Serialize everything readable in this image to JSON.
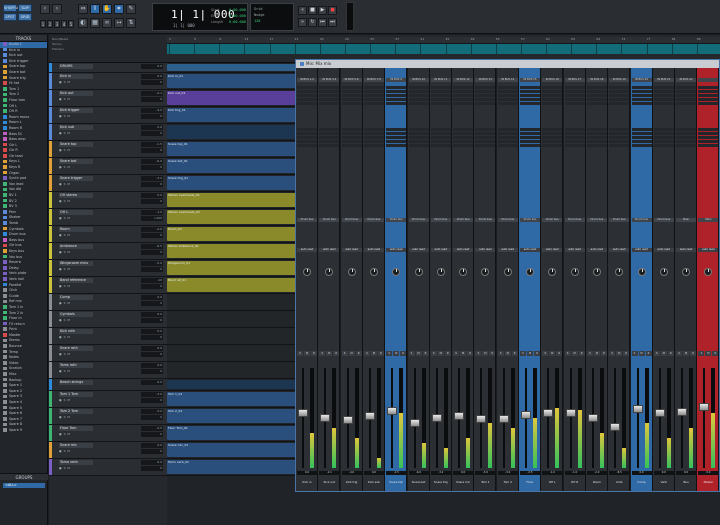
{
  "transport": {
    "mode_buttons": [
      "SHUFFLE",
      "SLIP",
      "SPOT",
      "GRID"
    ],
    "counter_main": "1| 1| 000",
    "counter_sub": "1| 1| 000",
    "counter_side_labels": [
      "Start",
      "End",
      "Length"
    ],
    "counter_side_values": [
      "0:00.000",
      "0:00.000",
      "0:00.000"
    ],
    "nudge_label": "Nudge",
    "grid_label": "Grid",
    "tempo_label": "120"
  },
  "sidebar": {
    "tracks_header": "TRACKS",
    "groups_header": "GROUPS",
    "group_all": "<ALL>",
    "items": [
      {
        "name": "Audio 1",
        "color": "#7b5fc2"
      },
      {
        "name": "Kick in",
        "color": "#5b8ad9"
      },
      {
        "name": "Kick out",
        "color": "#5b8ad9"
      },
      {
        "name": "Kick trigger",
        "color": "#5b8ad9"
      },
      {
        "name": "Snare top",
        "color": "#e0a038"
      },
      {
        "name": "Snare bot",
        "color": "#e0a038"
      },
      {
        "name": "Snare trig",
        "color": "#e0a038"
      },
      {
        "name": "Hi hat",
        "color": "#d94a4a"
      },
      {
        "name": "Tom 1",
        "color": "#3fb573"
      },
      {
        "name": "Tom 2",
        "color": "#3fb573"
      },
      {
        "name": "Floor tom",
        "color": "#3fb573"
      },
      {
        "name": "OH L",
        "color": "#3fb573"
      },
      {
        "name": "OH R",
        "color": "#3fb573"
      },
      {
        "name": "Room mono",
        "color": "#2f8ad9"
      },
      {
        "name": "Room L",
        "color": "#2f8ad9"
      },
      {
        "name": "Room R",
        "color": "#2f8ad9"
      },
      {
        "name": "Bass DI",
        "color": "#c35fc2"
      },
      {
        "name": "Bass amp",
        "color": "#c35fc2"
      },
      {
        "name": "Gtr L",
        "color": "#d94a4a"
      },
      {
        "name": "Gtr R",
        "color": "#d94a4a"
      },
      {
        "name": "Gtr lead",
        "color": "#d94a4a"
      },
      {
        "name": "Keys L",
        "color": "#e0a038"
      },
      {
        "name": "Keys R",
        "color": "#e0a038"
      },
      {
        "name": "Organ",
        "color": "#e0a038"
      },
      {
        "name": "Synth pad",
        "color": "#7b5fc2"
      },
      {
        "name": "Vox lead",
        "color": "#3fb573"
      },
      {
        "name": "Vox dbl",
        "color": "#3fb573"
      },
      {
        "name": "BV 1",
        "color": "#3fb573"
      },
      {
        "name": "BV 2",
        "color": "#3fb573"
      },
      {
        "name": "BV 3",
        "color": "#3fb573"
      },
      {
        "name": "Perc",
        "color": "#5b8ad9"
      },
      {
        "name": "Shaker",
        "color": "#5b8ad9"
      },
      {
        "name": "Tamb",
        "color": "#5b8ad9"
      },
      {
        "name": "Cymbals",
        "color": "#e0a038"
      },
      {
        "name": "Drum bus",
        "color": "#2f8ad9"
      },
      {
        "name": "Bass bus",
        "color": "#c35fc2"
      },
      {
        "name": "Gtr bus",
        "color": "#d94a4a"
      },
      {
        "name": "Keys bus",
        "color": "#e0a038"
      },
      {
        "name": "Vox bus",
        "color": "#3fb573"
      },
      {
        "name": "Reverb",
        "color": "#7b5fc2"
      },
      {
        "name": "Delay",
        "color": "#7b5fc2"
      },
      {
        "name": "Verb plate",
        "color": "#7b5fc2"
      },
      {
        "name": "Verb hall",
        "color": "#7b5fc2"
      },
      {
        "name": "Parallel",
        "color": "#2f8ad9"
      },
      {
        "name": "Click",
        "color": "#8a8f96"
      },
      {
        "name": "Guide",
        "color": "#8a8f96"
      },
      {
        "name": "Ref mix",
        "color": "#8a8f96"
      },
      {
        "name": "Tom 1 in",
        "color": "#3fb573"
      },
      {
        "name": "Tom 2 in",
        "color": "#3fb573"
      },
      {
        "name": "Floor in",
        "color": "#3fb573"
      },
      {
        "name": "FX return",
        "color": "#7b5fc2"
      },
      {
        "name": "Print",
        "color": "#8a8f96"
      },
      {
        "name": "Master",
        "color": "#d94a4a"
      },
      {
        "name": "Stems",
        "color": "#8a8f96"
      },
      {
        "name": "Bounce",
        "color": "#8a8f96"
      },
      {
        "name": "Temp",
        "color": "#8a8f96"
      },
      {
        "name": "Notes",
        "color": "#8a8f96"
      },
      {
        "name": "Video",
        "color": "#8a8f96"
      },
      {
        "name": "Scratch",
        "color": "#8a8f96"
      },
      {
        "name": "Misc",
        "color": "#8a8f96"
      },
      {
        "name": "Backup",
        "color": "#8a8f96"
      },
      {
        "name": "Spare 1",
        "color": "#8a8f96"
      },
      {
        "name": "Spare 2",
        "color": "#8a8f96"
      },
      {
        "name": "Spare 3",
        "color": "#8a8f96"
      },
      {
        "name": "Spare 4",
        "color": "#8a8f96"
      },
      {
        "name": "Spare 5",
        "color": "#8a8f96"
      },
      {
        "name": "Spare 6",
        "color": "#8a8f96"
      },
      {
        "name": "Spare 7",
        "color": "#8a8f96"
      },
      {
        "name": "Spare 8",
        "color": "#8a8f96"
      },
      {
        "name": "Spare 9",
        "color": "#8a8f96"
      }
    ]
  },
  "edit": {
    "ruler_names": [
      "Bars|Beats",
      "Tempo",
      "Markers"
    ],
    "ruler_ticks": [
      "1",
      "5",
      "9",
      "13",
      "17",
      "21",
      "25",
      "29",
      "33",
      "37",
      "41",
      "45",
      "49",
      "53",
      "57",
      "61",
      "65",
      "69",
      "73",
      "77",
      "81",
      "85"
    ],
    "tracks": [
      {
        "name": "DRUMS",
        "color": "#2f8ad9",
        "vol": "0.0",
        "vol2": "0",
        "clip_color": "#2d5f8a",
        "clip_label": "",
        "h": 10
      },
      {
        "name": "Kick in",
        "color": "#5b8ad9",
        "vol": "0.0",
        "vol2": "0",
        "clip_color": "#2a4f7d",
        "clip_label": "Kick in_01",
        "h": 17
      },
      {
        "name": "Kick out",
        "color": "#5b8ad9",
        "vol": "-2.1",
        "vol2": "0",
        "clip_color": "#5a3f9a",
        "clip_label": "Kick out_01",
        "h": 17
      },
      {
        "name": "Kick trigger",
        "color": "#5b8ad9",
        "vol": "-4.0",
        "vol2": "0",
        "clip_color": "#2a4f7d",
        "clip_label": "Kick trig_01",
        "h": 17
      },
      {
        "name": "Kick sub",
        "color": "#5b8ad9",
        "vol": "0.0",
        "vol2": "0",
        "clip_color": "#1c3550",
        "clip_label": "",
        "h": 17
      },
      {
        "name": "Snare top",
        "color": "#e0a038",
        "vol": "-1.5",
        "vol2": "0",
        "clip_color": "#2a4f7d",
        "clip_label": "Snare top_01",
        "h": 17
      },
      {
        "name": "Snare bot",
        "color": "#e0a038",
        "vol": "-6.0",
        "vol2": "0",
        "clip_color": "#2a4f7d",
        "clip_label": "Snare bot_01",
        "h": 17
      },
      {
        "name": "Snare trigger",
        "color": "#e0a038",
        "vol": "-3.2",
        "vol2": "0",
        "clip_color": "#2a4f7d",
        "clip_label": "Snare trig_01",
        "h": 17
      },
      {
        "name": "OH stereo",
        "color": "#c9c43b",
        "vol": "0.0",
        "vol2": "0",
        "clip_color": "#8a8a2a",
        "clip_label": "Stereo overheads_01",
        "h": 17
      },
      {
        "name": "OH L",
        "color": "#c9c43b",
        "vol": "-1.0",
        "vol2": "<100",
        "clip_color": "#8a8a2a",
        "clip_label": "Stereo overheads_02",
        "h": 17
      },
      {
        "name": "Room",
        "color": "#c9c43b",
        "vol": "-2.0",
        "vol2": "0",
        "clip_color": "#8a8a2a",
        "clip_label": "Room_01",
        "h": 17
      },
      {
        "name": "Ambiance",
        "color": "#c9c43b",
        "vol": "-8.5",
        "vol2": "0",
        "clip_color": "#8a8a2a",
        "clip_label": "Stereo ambiance_01",
        "h": 17
      },
      {
        "name": "Wingsroom mics",
        "color": "#c9c43b",
        "vol": "-5.0",
        "vol2": "0",
        "clip_color": "#8a8a2a",
        "clip_label": "Wingsroom_01",
        "h": 17
      },
      {
        "name": "Band reference",
        "color": "#c9c43b",
        "vol": "-10",
        "vol2": "0",
        "clip_color": "#8a8a2a",
        "clip_label": "Band ref_01",
        "h": 17
      },
      {
        "name": "Comp",
        "color": "#8a8f96",
        "vol": "0.0",
        "vol2": "0",
        "clip_color": "#232629",
        "clip_label": "",
        "h": 17
      },
      {
        "name": "Cymbals",
        "color": "#8a8f96",
        "vol": "0.0",
        "vol2": "0",
        "clip_color": "#232629",
        "clip_label": "",
        "h": 17
      },
      {
        "name": "Kick roth",
        "color": "#8a8f96",
        "vol": "0.0",
        "vol2": "0",
        "clip_color": "#232629",
        "clip_label": "",
        "h": 17
      },
      {
        "name": "Snare roth",
        "color": "#8a8f96",
        "vol": "0.0",
        "vol2": "0",
        "clip_color": "#232629",
        "clip_label": "",
        "h": 17
      },
      {
        "name": "Toms roth",
        "color": "#8a8f96",
        "vol": "0.0",
        "vol2": "0",
        "clip_color": "#232629",
        "clip_label": "",
        "h": 17
      },
      {
        "name": "Beach strings",
        "color": "#2f8ad9",
        "vol": "0.0",
        "vol2": "0",
        "clip_color": "#1c3550",
        "clip_label": "",
        "h": 12
      },
      {
        "name": "Tom 1 Tom",
        "color": "#3fb573",
        "vol": "-3.0",
        "vol2": "0",
        "clip_color": "#2a4f7d",
        "clip_label": "Tom 1_01",
        "h": 17
      },
      {
        "name": "Tom 2 Tom",
        "color": "#3fb573",
        "vol": "-3.0",
        "vol2": "0",
        "clip_color": "#2a4f7d",
        "clip_label": "Tom 2_01",
        "h": 17
      },
      {
        "name": "Floor Tom",
        "color": "#3fb573",
        "vol": "-2.5",
        "vol2": "0",
        "clip_color": "#2a4f7d",
        "clip_label": "Floor Tom_01",
        "h": 17
      },
      {
        "name": "Snare mic",
        "color": "#e0a038",
        "vol": "0.0",
        "vol2": "0",
        "clip_color": "#2a4f7d",
        "clip_label": "Snare mic_01",
        "h": 17
      },
      {
        "name": "Tomo verb",
        "color": "#7b5fc2",
        "vol": "0.0",
        "vol2": "0",
        "clip_color": "#2a4f7d",
        "clip_label": "Tomo verb_01",
        "h": 17
      }
    ]
  },
  "mix": {
    "title": "Mix: Mix mix",
    "strips": [
      {
        "name": "Kick in",
        "input": "IN BUS 1-2",
        "output": "Drum bus",
        "auto": "auto read",
        "readout": "0.0",
        "fader_pct": 0.55,
        "meter_pct": 0.35,
        "color": "#2c3035"
      },
      {
        "name": "Kick out",
        "input": "IN BUS 3-4",
        "output": "Drum bus",
        "auto": "auto read",
        "readout": "-2.1",
        "fader_pct": 0.5,
        "meter_pct": 0.4,
        "color": "#2c3035"
      },
      {
        "name": "Kick trig",
        "input": "IN BUS 5-6",
        "output": "Drum bus",
        "auto": "auto read",
        "readout": "-4.0",
        "fader_pct": 0.48,
        "meter_pct": 0.3,
        "color": "#2c3035"
      },
      {
        "name": "Kick sub",
        "input": "IN BUS 7-8",
        "output": "Drum bus",
        "auto": "auto read",
        "readout": "0.0",
        "fader_pct": 0.52,
        "meter_pct": 0.1,
        "color": "#2c3035"
      },
      {
        "name": "Snare top",
        "input": "IN BUS 9",
        "output": "Drum bus",
        "auto": "auto read",
        "readout": "-1.5",
        "fader_pct": 0.58,
        "meter_pct": 0.55,
        "color": "#2f6aa6"
      },
      {
        "name": "Snare bot",
        "input": "IN BUS 10",
        "output": "Drum bus",
        "auto": "auto read",
        "readout": "-6.0",
        "fader_pct": 0.45,
        "meter_pct": 0.25,
        "color": "#2c3035"
      },
      {
        "name": "Snare trig",
        "input": "IN BUS 11",
        "output": "Drum bus",
        "auto": "auto read",
        "readout": "-3.2",
        "fader_pct": 0.5,
        "meter_pct": 0.2,
        "color": "#2c3035"
      },
      {
        "name": "Snare mic",
        "input": "IN BUS 12",
        "output": "Drum bus",
        "auto": "auto read",
        "readout": "0.0",
        "fader_pct": 0.52,
        "meter_pct": 0.3,
        "color": "#2c3035"
      },
      {
        "name": "Tom 1",
        "input": "IN BUS 13",
        "output": "Drum bus",
        "auto": "auto read",
        "readout": "-3.0",
        "fader_pct": 0.49,
        "meter_pct": 0.45,
        "color": "#2c3035"
      },
      {
        "name": "Tom 2",
        "input": "IN BUS 14",
        "output": "Drum bus",
        "auto": "auto read",
        "readout": "-3.0",
        "fader_pct": 0.49,
        "meter_pct": 0.4,
        "color": "#2c3035"
      },
      {
        "name": "Floor",
        "input": "IN BUS 15",
        "output": "Drum bus",
        "auto": "auto read",
        "readout": "-2.5",
        "fader_pct": 0.53,
        "meter_pct": 0.5,
        "color": "#2f6aa6"
      },
      {
        "name": "OH L",
        "input": "IN BUS 16",
        "output": "Drum bus",
        "auto": "auto read",
        "readout": "-1.0",
        "fader_pct": 0.55,
        "meter_pct": 0.6,
        "color": "#2c3035"
      },
      {
        "name": "OH R",
        "input": "IN BUS 17",
        "output": "Drum bus",
        "auto": "auto read",
        "readout": "-1.0",
        "fader_pct": 0.55,
        "meter_pct": 0.58,
        "color": "#2c3035"
      },
      {
        "name": "Room",
        "input": "IN BUS 18",
        "output": "Drum bus",
        "auto": "auto read",
        "readout": "-2.0",
        "fader_pct": 0.5,
        "meter_pct": 0.35,
        "color": "#2c3035"
      },
      {
        "name": "Amb",
        "input": "IN BUS 19",
        "output": "Drum bus",
        "auto": "auto read",
        "readout": "-8.5",
        "fader_pct": 0.4,
        "meter_pct": 0.2,
        "color": "#2c3035"
      },
      {
        "name": "Comp",
        "input": "IN BUS 20",
        "output": "Drum bus",
        "auto": "auto read",
        "readout": "0.0",
        "fader_pct": 0.6,
        "meter_pct": 0.45,
        "color": "#2f6aa6"
      },
      {
        "name": "Verb",
        "input": "IN BUS 21",
        "output": "Drum bus",
        "auto": "auto read",
        "readout": "0.0",
        "fader_pct": 0.55,
        "meter_pct": 0.3,
        "color": "#2c3035"
      },
      {
        "name": "Bus",
        "input": "IN BUS 22",
        "output": "Main",
        "auto": "auto read",
        "readout": "0.0",
        "fader_pct": 0.57,
        "meter_pct": 0.4,
        "color": "#2c3035"
      },
      {
        "name": "Master",
        "input": "",
        "output": "Main",
        "auto": "auto read",
        "readout": "0.0",
        "fader_pct": 0.62,
        "meter_pct": 0.55,
        "color": "#b0222a"
      }
    ]
  }
}
